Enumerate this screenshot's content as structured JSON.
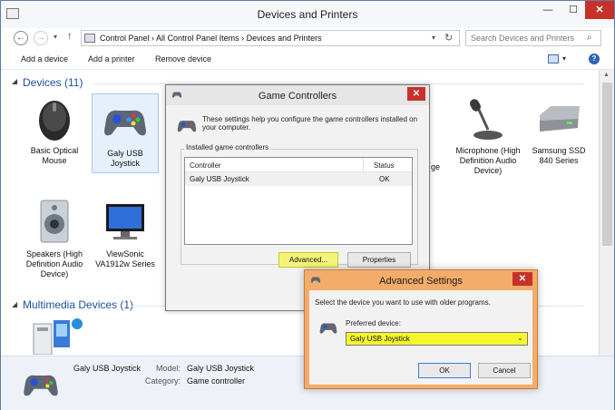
{
  "window": {
    "title": "Devices and Printers",
    "minimize": "—",
    "maximize": "☐",
    "close": "✕"
  },
  "nav": {
    "back": "←",
    "forward": "→",
    "up": "↑",
    "refresh": "↻",
    "breadcrumb": "Control Panel  ›  All Control Panel Items  ›  Devices and Printers",
    "search_placeholder": "Search Devices and Printers"
  },
  "toolbar": {
    "add_device": "Add a device",
    "add_printer": "Add a printer",
    "remove_device": "Remove device"
  },
  "devices_group": {
    "title": "Devices (11)",
    "items": [
      {
        "label": "Basic Optical Mouse"
      },
      {
        "label": "Galy USB Joystick"
      },
      {
        "label": "Speakers (High Definition Audio Device)"
      },
      {
        "label": "ViewSonic VA1912w Series"
      },
      {
        "label": "ge"
      },
      {
        "label": "Microphone (High Definition Audio Device)"
      },
      {
        "label": "Samsung SSD 840 Series"
      }
    ]
  },
  "multimedia_group": {
    "title": "Multimedia Devices (1)"
  },
  "details": {
    "device_name": "Galy USB Joystick",
    "model_label": "Model:",
    "model_value": "Galy USB Joystick",
    "category_label": "Category:",
    "category_value": "Game controller"
  },
  "game_controllers": {
    "title": "Game Controllers",
    "close": "✕",
    "description": "These settings help you configure the game controllers installed on your computer.",
    "group_label": "Installed game controllers",
    "columns": [
      "Controller",
      "Status"
    ],
    "rows": [
      {
        "controller": "Galy USB Joystick",
        "status": "OK"
      }
    ],
    "advanced": "Advanced...",
    "properties": "Properties"
  },
  "advanced_settings": {
    "title": "Advanced Settings",
    "close": "✕",
    "description": "Select the device you want to use with older programs.",
    "preferred_label": "Preferred device:",
    "preferred_value": "Galy USB Joystick",
    "ok": "OK",
    "cancel": "Cancel"
  },
  "colors": {
    "accent": "#1e4f9c",
    "highlight": "#f6f62c",
    "dialog_frame": "#f3ac69",
    "close_button": "#c7312a"
  }
}
